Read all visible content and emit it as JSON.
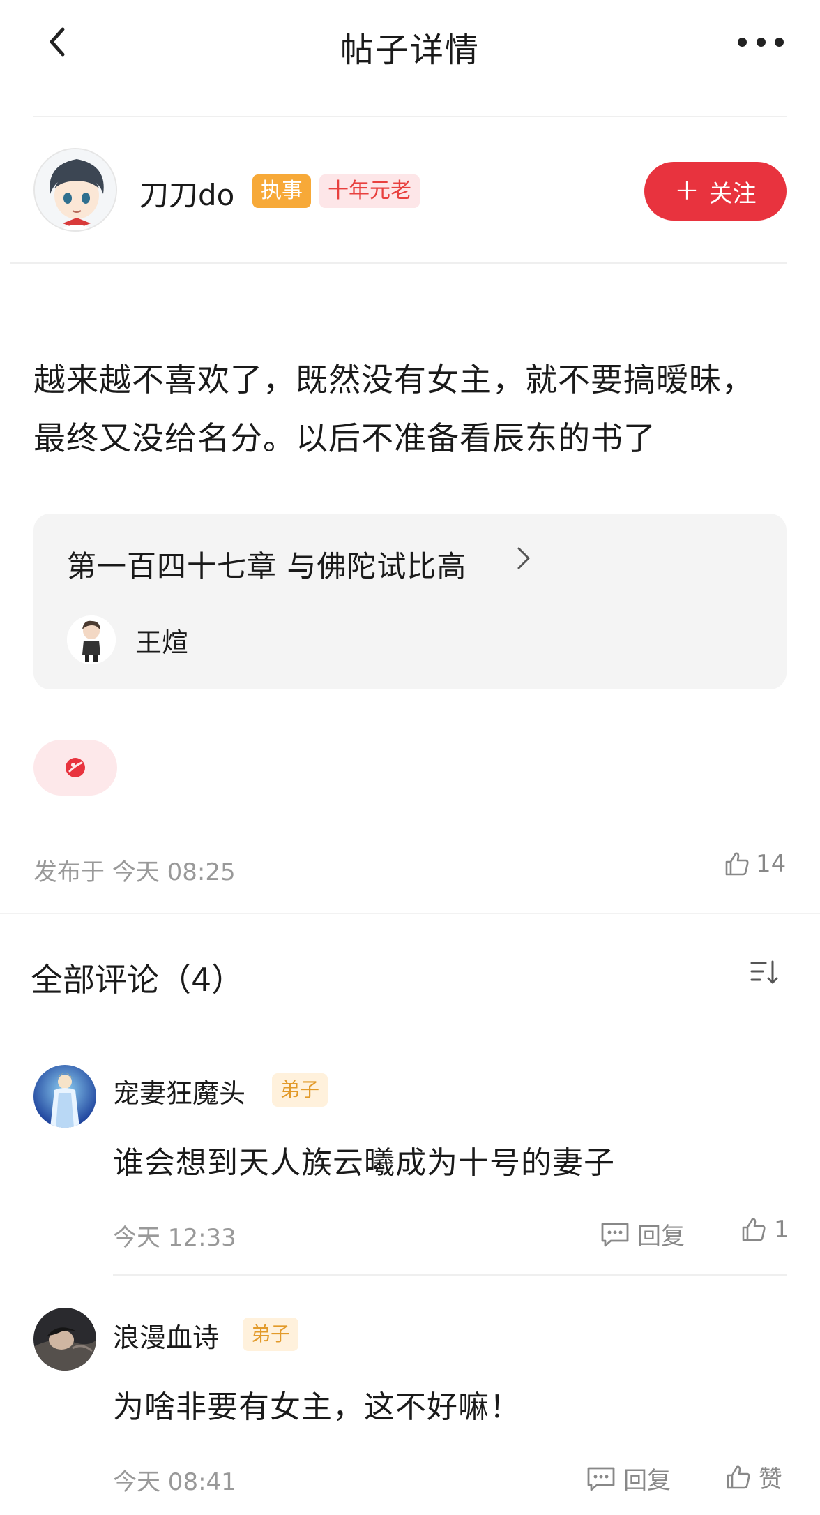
{
  "header": {
    "title": "帖子详情"
  },
  "author": {
    "name": "刀刀do",
    "badges": [
      "执事",
      "十年元老"
    ],
    "follow_label": "关注"
  },
  "post": {
    "content": "越来越不喜欢了，既然没有女主，就不要搞暧昧，最终又没给名分。以后不准备看辰东的书了",
    "chapter_title": "第一百四十七章 与佛陀试比高",
    "book_character": "王煊",
    "published": "发布于 今天 08:25",
    "likes": "14"
  },
  "comments_section": {
    "title": "全部评论（4）",
    "items": [
      {
        "name": "宠妻狂魔头",
        "badge": "弟子",
        "text": "谁会想到天人族云曦成为十号的妻子",
        "time": "今天 12:33",
        "reply_label": "回复",
        "like_label": "1"
      },
      {
        "name": "浪漫血诗",
        "badge": "弟子",
        "text": "为啥非要有女主，这不好嘛！",
        "time": "今天 08:41",
        "reply_label": "回复",
        "like_label": "赞"
      }
    ]
  },
  "colors": {
    "accent": "#e8333e",
    "deacon_badge": "#f7a938",
    "veteran_badge_bg": "#fde6e8",
    "disciple_badge_bg": "#fff1dc"
  },
  "icons": [
    "back-icon",
    "more-icon",
    "plus-icon",
    "chevron-right-icon",
    "tag-icon",
    "thumb-up-icon",
    "sort-icon",
    "reply-icon"
  ]
}
